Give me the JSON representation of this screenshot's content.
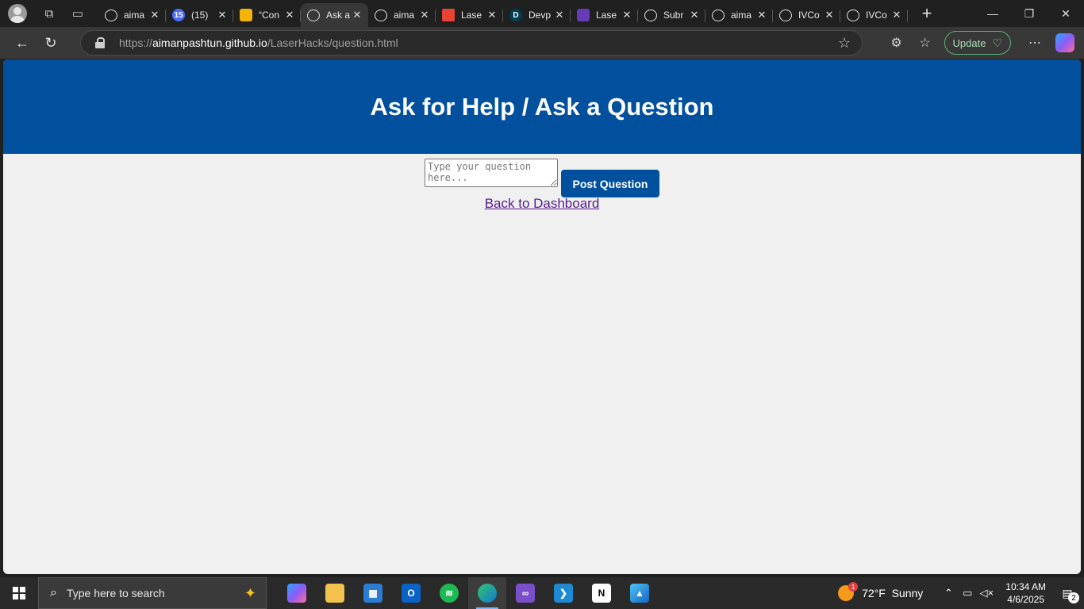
{
  "browser": {
    "tabs": [
      {
        "label": "aima",
        "icon": "github-icon",
        "color": "#202020"
      },
      {
        "label": "(15)",
        "icon": "tab-badge-icon",
        "color": "#4a6cf7",
        "badge": "15"
      },
      {
        "label": "“Con",
        "icon": "slides-icon",
        "color": "#f4b400"
      },
      {
        "label": "Ask a",
        "icon": "globe-icon",
        "color": "#383838",
        "active": true
      },
      {
        "label": "aima",
        "icon": "github-icon",
        "color": "#202020"
      },
      {
        "label": "Lase",
        "icon": "gmail-icon",
        "color": "#ea4335"
      },
      {
        "label": "Devp",
        "icon": "devpost-icon",
        "color": "#003e54",
        "letter": "D"
      },
      {
        "label": "Lase",
        "icon": "forms-icon",
        "color": "#673ab7"
      },
      {
        "label": "Subr",
        "icon": "openai-icon",
        "color": "#202020"
      },
      {
        "label": "aima",
        "icon": "github-icon",
        "color": "#202020"
      },
      {
        "label": "IVCo",
        "icon": "globe-icon",
        "color": "#202020"
      },
      {
        "label": "IVCo",
        "icon": "globe-icon",
        "color": "#202020"
      }
    ],
    "url_host": "aimanpashtun.github.io",
    "url_prefix": "https://",
    "url_path": "/LaserHacks/question.html",
    "update_label": "Update"
  },
  "page": {
    "title": "Ask for Help / Ask a Question",
    "question_placeholder": "Type your question here...",
    "post_button": "Post Question",
    "back_link": "Back to Dashboard",
    "brand_color": "#00509d"
  },
  "taskbar": {
    "search_placeholder": "Type here to search",
    "weather_temp": "72°F",
    "weather_desc": "Sunny",
    "weather_badge": "1",
    "time": "10:34 AM",
    "date": "4/6/2025",
    "notification_count": "2"
  }
}
